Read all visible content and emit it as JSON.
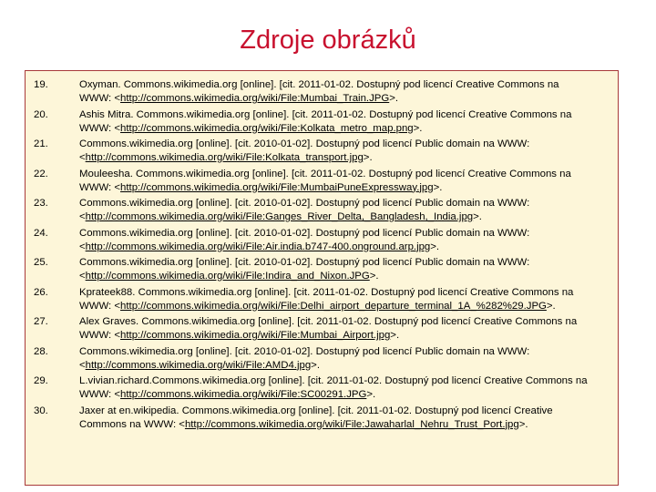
{
  "title": "Zdroje obrázků",
  "refs": [
    {
      "num": "19.",
      "l1": "Oxyman. Commons.wikimedia.org [online]. [cit. 2011-01-02. Dostupný pod licencí Creative Commons na",
      "pre": "WWW: <",
      "url": "http://commons.wikimedia.org/wiki/File:Mumbai_Train.JPG",
      "post": ">."
    },
    {
      "num": "20.",
      "l1": "Ashis Mitra. Commons.wikimedia.org [online]. [cit. 2011-01-02. Dostupný pod licencí Creative Commons na",
      "pre": "WWW: <",
      "url": "http://commons.wikimedia.org/wiki/File:Kolkata_metro_map.png",
      "post": ">."
    },
    {
      "num": "21.",
      "l1": "Commons.wikimedia.org [online]. [cit. 2010-01-02]. Dostupný pod licencí Public domain na WWW:",
      "pre": "<",
      "url": "http://commons.wikimedia.org/wiki/File:Kolkata_transport.jpg",
      "post": ">."
    },
    {
      "num": "22.",
      "l1": "Mouleesha. Commons.wikimedia.org [online]. [cit. 2011-01-02. Dostupný pod licencí Creative Commons na",
      "pre": "WWW: <",
      "url": "http://commons.wikimedia.org/wiki/File:MumbaiPuneExpressway.jpg",
      "post": ">."
    },
    {
      "num": "23.",
      "l1": "Commons.wikimedia.org [online]. [cit. 2010-01-02]. Dostupný pod licencí Public domain na WWW:",
      "pre": "<",
      "url": "http://commons.wikimedia.org/wiki/File:Ganges_River_Delta,_Bangladesh,_India.jpg",
      "post": ">."
    },
    {
      "num": "24.",
      "l1": "Commons.wikimedia.org [online]. [cit. 2010-01-02]. Dostupný pod licencí Public domain na WWW:",
      "pre": "<",
      "url": "http://commons.wikimedia.org/wiki/File:Air.india.b747-400.onground.arp.jpg",
      "post": ">."
    },
    {
      "num": "25.",
      "l1": "Commons.wikimedia.org [online]. [cit. 2010-01-02]. Dostupný pod licencí Public domain na WWW:",
      "pre": "<",
      "url": "http://commons.wikimedia.org/wiki/File:Indira_and_Nixon.JPG",
      "post": ">."
    },
    {
      "num": "26.",
      "l1": "Kprateek88. Commons.wikimedia.org [online]. [cit. 2011-01-02. Dostupný pod licencí Creative Commons na",
      "pre": "WWW: <",
      "url": "http://commons.wikimedia.org/wiki/File:Delhi_airport_departure_terminal_1A_%282%29.JPG",
      "post": ">."
    },
    {
      "num": "27.",
      "l1": "Alex Graves. Commons.wikimedia.org [online]. [cit. 2011-01-02. Dostupný pod licencí Creative Commons na",
      "pre": "WWW: <",
      "url": "http://commons.wikimedia.org/wiki/File:Mumbai_Airport.jpg",
      "post": ">."
    },
    {
      "num": "28.",
      "l1": "Commons.wikimedia.org [online]. [cit. 2010-01-02]. Dostupný pod licencí Public domain na WWW:",
      "pre": "<",
      "url": "http://commons.wikimedia.org/wiki/File:AMD4.jpg",
      "post": ">."
    },
    {
      "num": "29.",
      "l1": "L.vivian.richard.Commons.wikimedia.org [online]. [cit. 2011-01-02. Dostupný pod licencí Creative Commons na",
      "pre": "WWW: <",
      "url": "http://commons.wikimedia.org/wiki/File:SC00291.JPG",
      "post": ">."
    },
    {
      "num": "30.",
      "l1": "Jaxer at en.wikipedia. Commons.wikimedia.org [online]. [cit. 2011-01-02. Dostupný pod licencí Creative",
      "pre": "Commons na WWW: <",
      "url": "http://commons.wikimedia.org/wiki/File:Jawaharlal_Nehru_Trust_Port.jpg",
      "post": ">."
    }
  ]
}
